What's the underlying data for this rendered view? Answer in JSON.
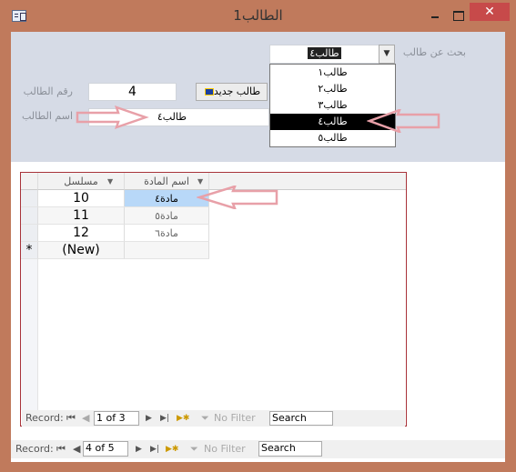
{
  "window": {
    "title": "الطالب1",
    "close_glyph": "✕"
  },
  "header": {
    "search_label": "بحث عن طالب",
    "search_value": "طالب٤",
    "dropdown_items": [
      "طالب١",
      "طالب٢",
      "طالب٣",
      "طالب٤",
      "طالب٥"
    ],
    "selected_index": 3,
    "id_label": "رقم الطالب",
    "id_value": "4",
    "new_button": "طالب جديد",
    "name_label": "اسم الطالب",
    "name_value": "طالب٤"
  },
  "subform": {
    "columns": [
      "مسلسل",
      "اسم المادة"
    ],
    "rows": [
      {
        "serial": "10",
        "subject": "مادة٤"
      },
      {
        "serial": "11",
        "subject": "مادة٥"
      },
      {
        "serial": "12",
        "subject": "مادة٦"
      }
    ],
    "new_row": "(New)",
    "new_marker": "*",
    "nav": {
      "label": "Record:",
      "position": "1 of 3",
      "filter": "No Filter",
      "search": "Search"
    }
  },
  "main_nav": {
    "label": "Record:",
    "position": "4 of 5",
    "filter": "No Filter",
    "search": "Search"
  },
  "colors": {
    "frame": "#c07a5c",
    "header_bg": "#d6dbe6",
    "subform_border": "#a8333a",
    "selected_cell": "#b8d8f8",
    "arrow": "#e8a0a8"
  }
}
